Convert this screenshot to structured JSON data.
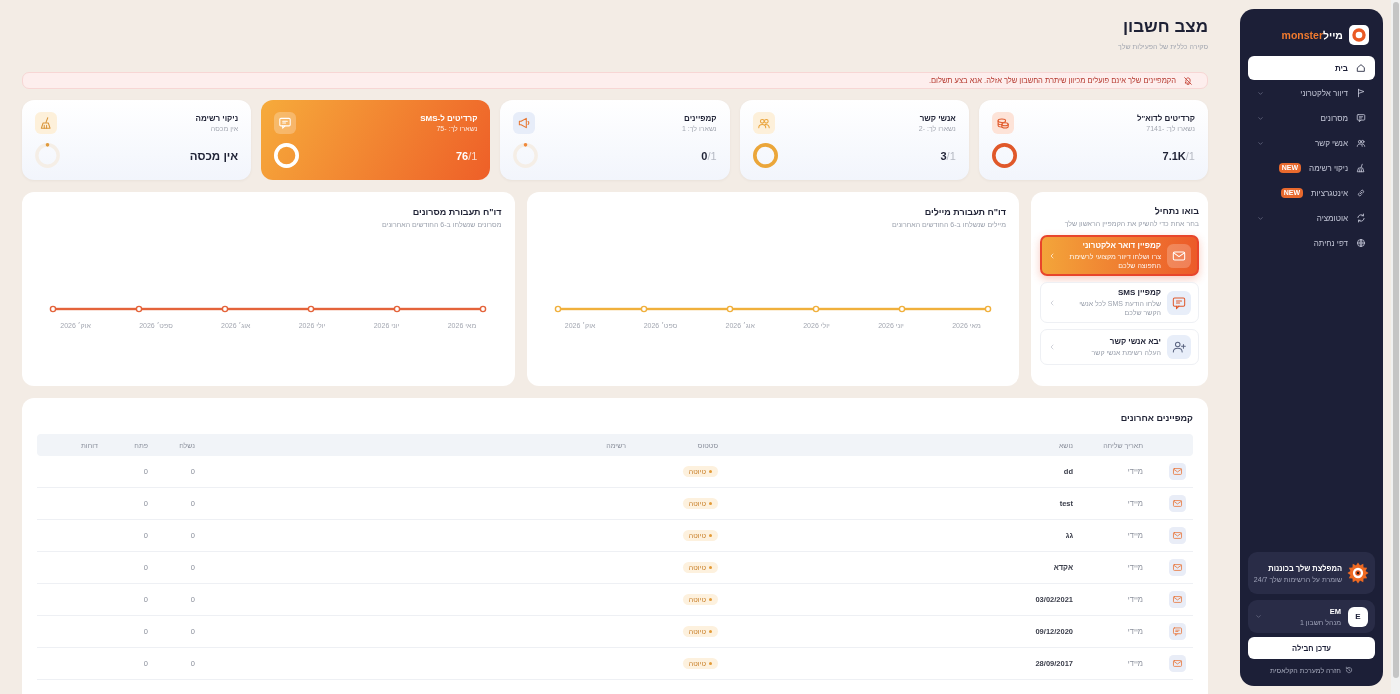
{
  "sidebar": {
    "logo": {
      "text_hebrew": "מייל",
      "text_latin": "monster"
    },
    "items": [
      {
        "label": "בית",
        "selected": true,
        "expandable": false
      },
      {
        "label": "דיוור אלקטרוני",
        "selected": false,
        "expandable": true
      },
      {
        "label": "מסרונים",
        "selected": false,
        "expandable": true
      },
      {
        "label": "אנשי קשר",
        "selected": false,
        "expandable": true
      },
      {
        "label": "ניקוי רשימה",
        "selected": false,
        "expandable": false,
        "badge": "NEW"
      },
      {
        "label": "אינטגרציות",
        "selected": false,
        "expandable": false,
        "badge": "NEW"
      },
      {
        "label": "אוטומציה",
        "selected": false,
        "expandable": true
      },
      {
        "label": "דפי נחיתה",
        "selected": false,
        "expandable": false
      }
    ],
    "promo": {
      "title": "המפלצת שלך בכוננות",
      "subtitle": "שומרת על הרשימות שלך 24/7"
    },
    "user": {
      "initial": "E",
      "name": "EM",
      "role": "מנהל חשבון 1"
    },
    "upgrade_button": "עדכן חבילה",
    "classic_link": "חזרה למערכת הקלאסית"
  },
  "header": {
    "title": "מצב חשבון",
    "subtitle": "סקירה כללית של הפעילות שלך"
  },
  "alert": {
    "text": "הקמפיינים שלך אינם פועלים מכיוון שיתרת החשבון שלך אזלה. אנא בצע תשלום."
  },
  "stats": [
    {
      "title": "קרדיטים לדוא\"ל",
      "subtitle": "נשארו לך: -7141",
      "amount": "7.1K",
      "of": "/1",
      "level": 1,
      "color": "#e0582a",
      "selected": false
    },
    {
      "title": "אנשי קשר",
      "subtitle": "נשארו לך: -2",
      "amount": "3",
      "of": "/1",
      "level": 1,
      "color": "#eba63a",
      "selected": false
    },
    {
      "title": "קמפיינים",
      "subtitle": "נשארו לך: 1",
      "amount": "0",
      "of": "/1",
      "level": 0,
      "color": "#f0893a",
      "selected": false
    },
    {
      "title": "קרדיטים ל-SMS",
      "subtitle": "נשארו לך: -75",
      "amount": "76",
      "of": "/1",
      "level": 1,
      "color": "#ffffff",
      "selected": true
    },
    {
      "title": "ניקוי רשימה",
      "subtitle": "אין מכסה",
      "amount": "אין מכסה",
      "level": 0,
      "color": "#e09a3c",
      "selected": false
    }
  ],
  "get_started": {
    "title": "בואו נתחיל",
    "subtitle": "בחר אחת כדי להשיק את הקמפיין הראשון שלך",
    "options": [
      {
        "title": "קמפיין דואר אלקטרוני",
        "description": "צרו ושלחו דיוור מקצועי לרשימת התפוצה שלכם",
        "selected": true
      },
      {
        "title": "קמפיין SMS",
        "description": "שלחו הודעת SMS לכל אנשי הקשר שלכם",
        "selected": false
      },
      {
        "title": "יבא אנשי קשר",
        "description": "העלה רשימת אנשי קשר",
        "selected": false
      }
    ]
  },
  "charts": [
    {
      "title": "דו\"ח תעבורת מיילים",
      "subtitle": "מיילים שנשלחו ב-6 החודשים האחרונים",
      "color": "#f0b03c",
      "x_labels": [
        "מאי 2026",
        "יוני 2026",
        "יולי 2026",
        "אוג׳ 2026",
        "ספט׳ 2026",
        "אוק׳ 2026"
      ]
    },
    {
      "title": "דו\"ח תעבורת מסרונים",
      "subtitle": "מסרונים שנשלחו ב-6 החודשים האחרונים",
      "color": "#e4633a",
      "x_labels": [
        "מאי 2026",
        "יוני 2026",
        "יולי 2026",
        "אוג׳ 2026",
        "ספט׳ 2026",
        "אוק׳ 2026"
      ]
    }
  ],
  "recent_campaigns": {
    "title": "קמפיינים אחרונים",
    "columns": [
      "תאריך שליחה",
      "נושא",
      "סטטוס",
      "רשימה",
      "נשלח",
      "פתח",
      "דוחות"
    ],
    "rows": [
      {
        "kind": "email",
        "date": "מיידי",
        "subject": "dd",
        "status": "טיוטה",
        "sent": "0",
        "opened": "0"
      },
      {
        "kind": "email",
        "date": "מיידי",
        "subject": "test",
        "status": "טיוטה",
        "sent": "0",
        "opened": "0"
      },
      {
        "kind": "email",
        "date": "מיידי",
        "subject": "גג",
        "status": "טיוטה",
        "sent": "0",
        "opened": "0"
      },
      {
        "kind": "email",
        "date": "מיידי",
        "subject": "אקדא",
        "status": "טיוטה",
        "sent": "0",
        "opened": "0"
      },
      {
        "kind": "email",
        "date": "מיידי",
        "subject": "03/02/2021",
        "status": "טיוטה",
        "sent": "0",
        "opened": "0"
      },
      {
        "kind": "sms",
        "date": "מיידי",
        "subject": "09/12/2020",
        "status": "טיוטה",
        "sent": "0",
        "opened": "0"
      },
      {
        "kind": "email",
        "date": "מיידי",
        "subject": "28/09/2017",
        "status": "טיוטה",
        "sent": "0",
        "opened": "0"
      }
    ]
  }
}
